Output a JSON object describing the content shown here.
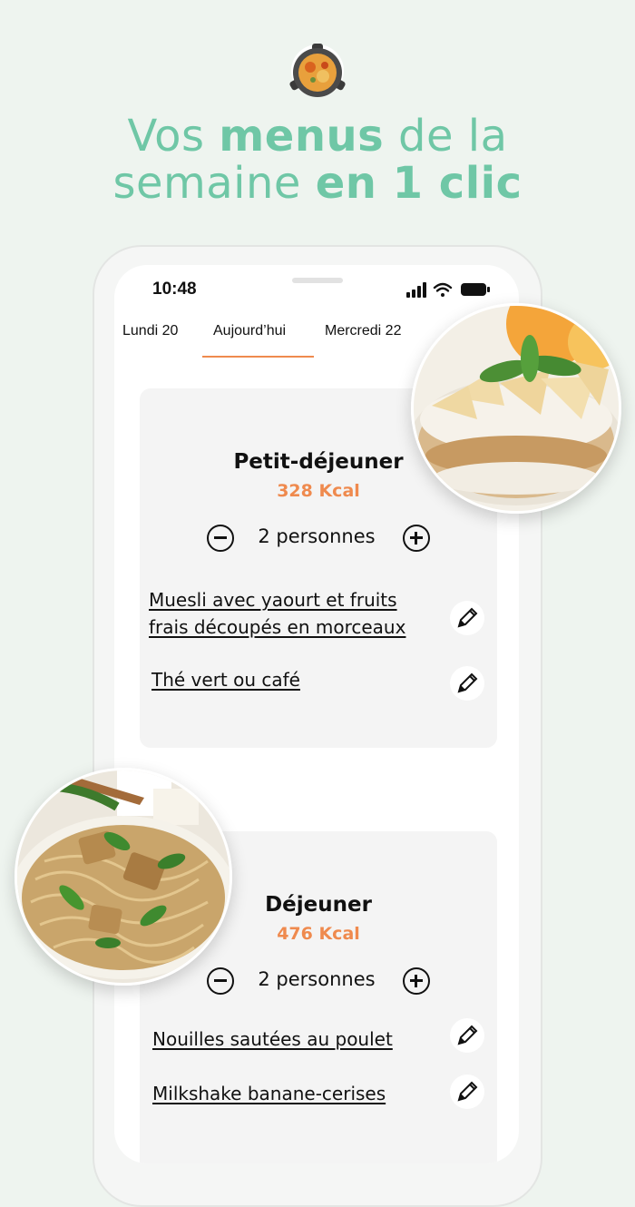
{
  "headline": {
    "line1_pre": "Vos ",
    "line1_bold": "menus",
    "line1_post": " de la",
    "line2_pre": "semaine ",
    "line2_bold": "en 1 clic"
  },
  "status_bar": {
    "time": "10:48"
  },
  "tabs": [
    {
      "label": "Lundi 20",
      "active": false
    },
    {
      "label": "Aujourd’hui",
      "active": true
    },
    {
      "label": "Mercredi 22",
      "active": false
    }
  ],
  "meals": [
    {
      "title": "Petit-déjeuner",
      "kcal": "328 Kcal",
      "persons": "2 personnes",
      "items": [
        {
          "line1": "Muesli avec yaourt et fruits",
          "line2": "frais découpés en morceaux"
        },
        {
          "line1": "Thé vert ou café"
        }
      ]
    },
    {
      "title": "Déjeuner",
      "kcal": "476 Kcal",
      "persons": "2 personnes",
      "items": [
        {
          "line1": "Nouilles sautées au poulet"
        },
        {
          "line1": "Milkshake banane-cerises"
        }
      ]
    }
  ],
  "colors": {
    "background": "#eef4ef",
    "headline": "#6fc7a6",
    "accent": "#ef8a4e",
    "card": "#f4f4f4"
  },
  "icons": {
    "logo": "paella-pan-icon",
    "minus": "minus-circle-icon",
    "plus": "plus-circle-icon",
    "edit": "pencil-icon"
  }
}
